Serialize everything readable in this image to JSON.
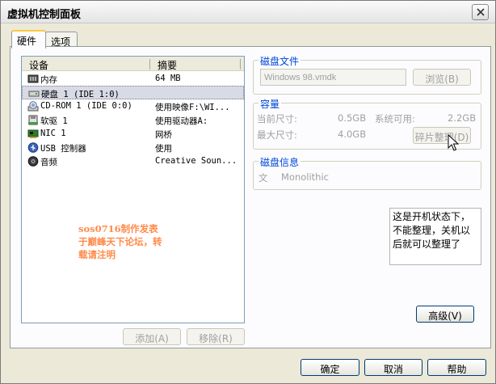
{
  "window": {
    "title": "虚拟机控制面板"
  },
  "tabs": [
    {
      "label": "硬件"
    },
    {
      "label": "选项"
    }
  ],
  "device_list": {
    "columns": {
      "device": "设备",
      "summary": "摘要"
    },
    "rows": [
      {
        "device": "内存",
        "summary": "64 MB",
        "icon": "memory-icon"
      },
      {
        "device": "硬盘 1 (IDE 1:0)",
        "summary": "",
        "icon": "hard-disk-icon"
      },
      {
        "device": "CD-ROM 1 (IDE 0:0)",
        "summary": "使用映像F:\\WI...",
        "icon": "cdrom-icon"
      },
      {
        "device": "软驱 1",
        "summary": "使用驱动器A:",
        "icon": "floppy-icon"
      },
      {
        "device": "NIC 1",
        "summary": "网桥",
        "icon": "network-card-icon"
      },
      {
        "device": "USB 控制器",
        "summary": "使用",
        "icon": "usb-icon"
      },
      {
        "device": "音频",
        "summary": "Creative Soun...",
        "icon": "speaker-icon"
      }
    ]
  },
  "watermark": "sos0716制作发表于巅峰天下论坛，转载请注明",
  "list_buttons": {
    "add": "添加(A)",
    "remove": "移除(R)"
  },
  "disk_file": {
    "title": "磁盘文件",
    "path": "Windows 98.vmdk",
    "browse": "浏览(B)"
  },
  "capacity": {
    "title": "容量",
    "current_label": "当前尺寸:",
    "current_value": "0.5GB",
    "available_label": "系统可用:",
    "available_value": "2.2GB",
    "max_label": "最大尺寸:",
    "max_value": "4.0GB",
    "defrag": "碎片整理(D)"
  },
  "disk_info": {
    "title": "磁盘信息",
    "label": "文",
    "value": "Monolithic"
  },
  "note": "这是开机状态下，不能整理，关机以后就可以整理了",
  "advanced": "高级(V)",
  "footer": {
    "ok": "确定",
    "cancel": "取消",
    "help": "帮助"
  }
}
